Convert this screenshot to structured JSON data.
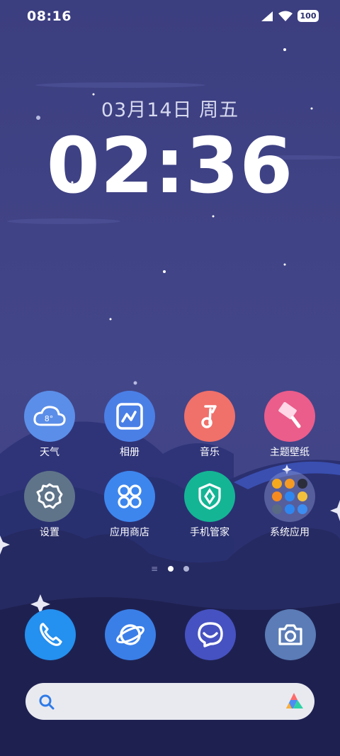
{
  "status_bar": {
    "time": "08:16",
    "battery": "100"
  },
  "lockscreen": {
    "date": "03月14日 周五",
    "clock": "02:36"
  },
  "apps": [
    {
      "label": "天气",
      "icon": "weather-icon",
      "temp": "8°"
    },
    {
      "label": "相册",
      "icon": "gallery-icon"
    },
    {
      "label": "音乐",
      "icon": "music-icon"
    },
    {
      "label": "主题壁纸",
      "icon": "themes-icon"
    },
    {
      "label": "设置",
      "icon": "settings-icon"
    },
    {
      "label": "应用商店",
      "icon": "app-store-icon"
    },
    {
      "label": "手机管家",
      "icon": "security-icon"
    },
    {
      "label": "系统应用",
      "icon": "system-apps-folder-icon"
    }
  ],
  "dock": [
    {
      "icon": "phone-icon"
    },
    {
      "icon": "browser-icon"
    },
    {
      "icon": "messages-icon"
    },
    {
      "icon": "camera-icon"
    }
  ],
  "page_indicator": {
    "pages": 2,
    "current": 1
  },
  "colors": {
    "wallpaper_top": "#3f4283",
    "weather": "#5b8ee8",
    "gallery": "#4a7fe6",
    "music": "#f0706a",
    "themes": "#eb5d8b",
    "settings": "#5f7489",
    "app_store": "#3d86ee",
    "security": "#14b595",
    "phone": "#2490ef",
    "browser": "#3a7fe8",
    "messages": "#4652c1",
    "camera": "#5b7cb6"
  }
}
